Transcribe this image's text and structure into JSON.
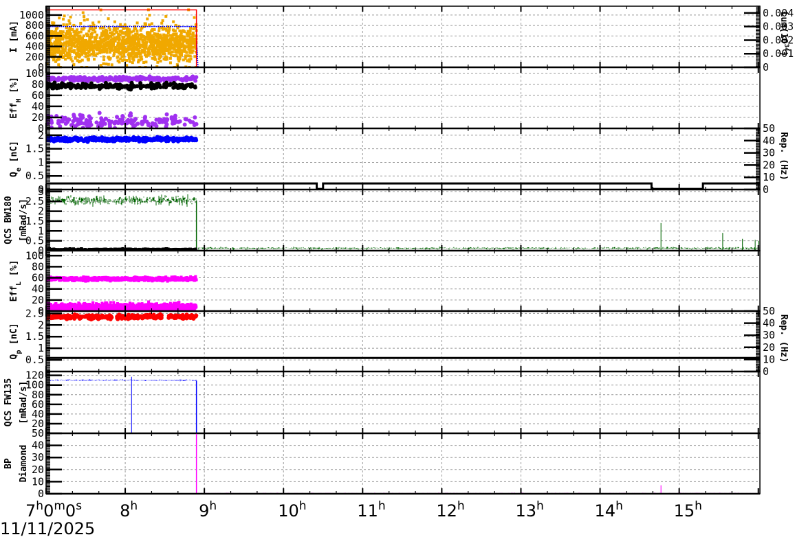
{
  "chart_data": {
    "type": "line",
    "title": "",
    "date_label": "11/11/2025",
    "xlim_hours": [
      7,
      16.02
    ],
    "x_ticks": [
      {
        "h": 7,
        "label": "7h0m0s"
      },
      {
        "h": 8,
        "label": "8h"
      },
      {
        "h": 9,
        "label": "9h"
      },
      {
        "h": 10,
        "label": "10h"
      },
      {
        "h": 11,
        "label": "11h"
      },
      {
        "h": 12,
        "label": "12h"
      },
      {
        "h": 13,
        "label": "13h"
      },
      {
        "h": 14,
        "label": "14h"
      },
      {
        "h": 15,
        "label": "15h"
      }
    ],
    "grid": true,
    "panels": [
      {
        "id": "current",
        "ylabel": [
          [
            "I [mA]"
          ]
        ],
        "ylim": [
          0,
          1170
        ],
        "yticks": [
          0,
          200,
          400,
          600,
          800,
          1000
        ],
        "ytick_labels": [
          "0",
          "200",
          "400",
          "600",
          "800",
          "1000"
        ],
        "right": {
          "label": "Lum(10^34)",
          "label_main": "Lum(10",
          "label_sup": "34",
          "label_end": ")",
          "ylim": [
            0,
            0.0045
          ],
          "ticks": [
            0,
            0.001,
            0.002,
            0.003,
            0.004
          ],
          "tick_labels": [
            "0",
            "0.001",
            "0.002",
            "0.003",
            "0.004"
          ]
        },
        "series": [
          {
            "name": "I-scatter",
            "kind": "scatter",
            "shape": "square",
            "color": "#f0a800",
            "t": [
              7,
              8.9
            ],
            "mean": 450,
            "spread": 170,
            "lo": 0,
            "hi": 1100,
            "n": 1400
          },
          {
            "name": "I-level",
            "kind": "line",
            "color": "#0000ff",
            "dotted": true,
            "points": [
              [
                7,
                780
              ],
              [
                8.9,
                780
              ],
              [
                8.9,
                560
              ],
              [
                8.92,
                0
              ],
              [
                16.02,
                0
              ]
            ]
          },
          {
            "name": "Lum",
            "kind": "line",
            "color": "#ff0000",
            "points": [
              [
                7,
                1100
              ],
              [
                8.9,
                1100
              ],
              [
                8.9,
                0
              ],
              [
                16.02,
                0
              ]
            ]
          }
        ]
      },
      {
        "id": "effH",
        "ylabel": [
          [
            "Eff",
            "H",
            " [%]"
          ]
        ],
        "ylim": [
          0,
          111
        ],
        "yticks": [
          0,
          20,
          40,
          60,
          80,
          100
        ],
        "ytick_labels": [
          "0",
          "20",
          "40",
          "60",
          "80",
          "100"
        ],
        "series": [
          {
            "name": "EffH-high",
            "kind": "scatter",
            "shape": "circle",
            "color": "#a030f0",
            "t": [
              7,
              8.9
            ],
            "mean": 90,
            "spread": 2,
            "n": 260
          },
          {
            "name": "EffH-total",
            "kind": "scatter",
            "shape": "circle",
            "color": "#000000",
            "t": [
              7,
              8.9
            ],
            "mean": 77,
            "spread": 2.5,
            "n": 240
          },
          {
            "name": "EffH-low",
            "kind": "scatter",
            "shape": "circle",
            "color": "#a030f0",
            "t": [
              7,
              8.9
            ],
            "mean": 13,
            "spread": 6,
            "n": 170
          }
        ]
      },
      {
        "id": "qe",
        "ylabel": [
          [
            "Q",
            "e",
            " [nC]"
          ]
        ],
        "ylim": [
          0,
          2.25
        ],
        "yticks": [
          0,
          0.5,
          1,
          1.5,
          2
        ],
        "ytick_labels": [
          "0",
          "0.5",
          "1",
          "1.5",
          "2"
        ],
        "right": {
          "label": "Rep. (Hz)",
          "ylim": [
            0,
            50
          ],
          "ticks": [
            0,
            10,
            20,
            30,
            40,
            50
          ],
          "tick_labels": [
            "0",
            "10",
            "20",
            "30",
            "40",
            "50"
          ]
        },
        "series": [
          {
            "name": "Qe",
            "kind": "scatter",
            "shape": "circle",
            "color": "#0000ff",
            "t": [
              7,
              8.9
            ],
            "mean": 1.85,
            "spread": 0.035,
            "n": 420
          },
          {
            "name": "Rep-e",
            "kind": "line",
            "color": "#000000",
            "width": 3,
            "axis": "right",
            "points": [
              [
                7,
                5
              ],
              [
                10.42,
                5
              ],
              [
                10.42,
                0.5
              ],
              [
                10.5,
                0.5
              ],
              [
                10.5,
                5
              ],
              [
                14.65,
                5
              ],
              [
                14.65,
                0.5
              ],
              [
                15.3,
                0.5
              ],
              [
                15.3,
                5
              ],
              [
                16.02,
                5
              ]
            ]
          }
        ]
      },
      {
        "id": "qcs-bw180",
        "ylabel": [
          [
            "QCS BW180"
          ],
          [
            "[mRad/s]"
          ]
        ],
        "ylim": [
          0,
          3.1
        ],
        "yticks": [
          0,
          0.5,
          1,
          1.5,
          2,
          2.5,
          3
        ],
        "ytick_labels": [
          "0",
          "0.5",
          "1",
          "1.5",
          "2",
          "2.5",
          "3"
        ],
        "series": [
          {
            "name": "BW180",
            "kind": "noise",
            "color": "#006400",
            "segments": [
              {
                "t": [
                  7,
                  8.9
                ],
                "mean": 2.55,
                "spread": 0.12
              },
              {
                "t": [
                  8.92,
                  16.02
                ],
                "mean": 0.12,
                "spread": 0.03
              }
            ],
            "spikes": [
              [
                14.77,
                1.4
              ],
              [
                15.55,
                0.9
              ],
              [
                15.8,
                0.6
              ],
              [
                15.96,
                0.55
              ],
              [
                16.0,
                0.5
              ]
            ],
            "drop": [
              8.9,
              2.55,
              0.12
            ]
          },
          {
            "name": "BW180-bg",
            "kind": "scatter",
            "shape": "square",
            "color": "#000000",
            "t": [
              7,
              8.9
            ],
            "mean": 0.04,
            "spread": 0.025,
            "n": 700
          }
        ]
      },
      {
        "id": "effL",
        "ylabel": [
          [
            "Eff",
            "L",
            " [%]"
          ]
        ],
        "ylim": [
          0,
          109
        ],
        "yticks": [
          0,
          20,
          40,
          60,
          80,
          100
        ],
        "ytick_labels": [
          "0",
          "20",
          "40",
          "60",
          "80",
          "100"
        ],
        "series": [
          {
            "name": "EffL-high",
            "kind": "scatter",
            "shape": "square",
            "color": "#ff00ff",
            "t": [
              7,
              8.9
            ],
            "mean": 58,
            "spread": 1.6,
            "n": 700
          },
          {
            "name": "EffL-low",
            "kind": "scatter",
            "shape": "square",
            "color": "#ff00ff",
            "t": [
              7,
              8.9
            ],
            "mean": 6,
            "spread": 4,
            "n": 1200
          }
        ]
      },
      {
        "id": "qp",
        "ylabel": [
          [
            "Q",
            "p",
            " [nC]"
          ]
        ],
        "ylim": [
          0,
          2.6
        ],
        "yticks": [
          0.5,
          1,
          1.5,
          2,
          2.5
        ],
        "ytick_labels": [
          "0.5",
          "1",
          "1.5",
          "2",
          "2.5"
        ],
        "right": {
          "label": "Rep. (Hz)",
          "ylim": [
            0,
            50
          ],
          "ticks": [
            0,
            10,
            20,
            30,
            40,
            50
          ],
          "tick_labels": [
            "0",
            "10",
            "20",
            "30",
            "40",
            "50"
          ]
        },
        "series": [
          {
            "name": "Qp",
            "kind": "scatter",
            "shape": "circle",
            "color": "#ff0000",
            "t": [
              7,
              8.9
            ],
            "mean": 2.35,
            "spread": 0.04,
            "n": 380,
            "gaps": [
              [
                7.83,
                7.88
              ],
              [
                8.32,
                8.34
              ],
              [
                8.47,
                8.53
              ]
            ]
          },
          {
            "name": "Rep-p",
            "kind": "line",
            "color": "#000000",
            "width": 3,
            "axis": "right",
            "points": [
              [
                7,
                11.2
              ],
              [
                16.02,
                11.2
              ]
            ]
          }
        ]
      },
      {
        "id": "qcs-fw135",
        "ylabel": [
          [
            "QCS FW135"
          ],
          [
            "[mRad/s]"
          ]
        ],
        "ylim": [
          0,
          128
        ],
        "yticks": [
          20,
          40,
          60,
          80,
          100,
          120
        ],
        "ytick_labels": [
          "20",
          "40",
          "60",
          "80",
          "100",
          "120"
        ],
        "series": [
          {
            "name": "FW135",
            "kind": "noise",
            "color": "#0000ff",
            "segments": [
              {
                "t": [
                  7,
                  8.9
                ],
                "mean": 110,
                "spread": 0.8
              }
            ],
            "spikes": [
              [
                8.08,
                117
              ]
            ],
            "drop": [
              8.9,
              109,
              0
            ]
          }
        ]
      },
      {
        "id": "bp-diamond",
        "ylabel": [
          [
            "BP"
          ],
          [
            "Diamond"
          ]
        ],
        "ylim": [
          0,
          50
        ],
        "yticks": [
          0,
          10,
          20,
          30,
          40,
          50
        ],
        "ytick_labels": [
          "0",
          "10",
          "20",
          "30",
          "40",
          "50"
        ],
        "series": [
          {
            "name": "Diamond",
            "kind": "noise",
            "color": "#ff00ff",
            "segments": [
              {
                "t": [
                  8.92,
                  16.02
                ],
                "mean": 0.4,
                "spread": 0.2
              }
            ],
            "spikes": [
              [
                14.77,
                7
              ]
            ],
            "drop": [
              8.9,
              50,
              0.4
            ]
          }
        ]
      }
    ]
  }
}
